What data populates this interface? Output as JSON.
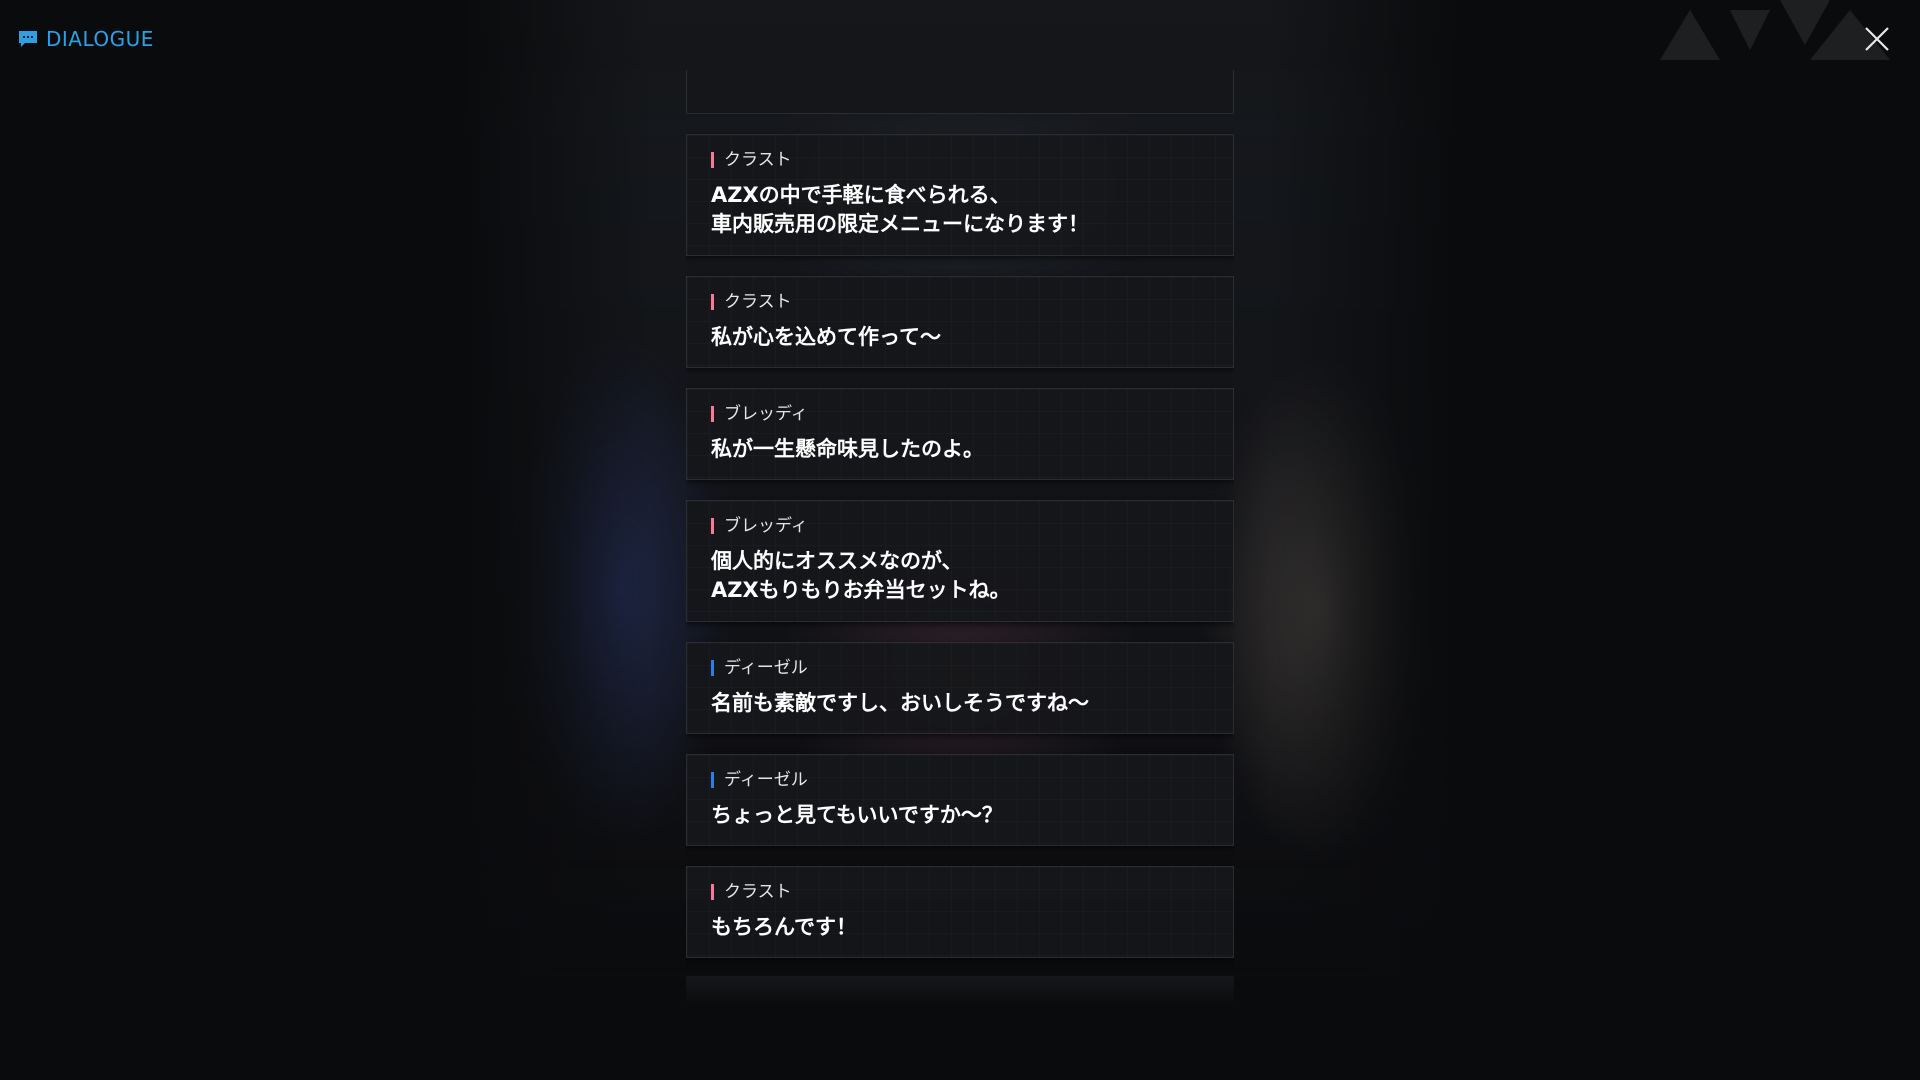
{
  "header": {
    "title": "DIALOGUE",
    "title_icon": "chat-bubble-icon",
    "close_icon": "close-icon"
  },
  "colors": {
    "accent": "#2f9fe4",
    "speaker_pink": "#f47c9a",
    "speaker_blue": "#2f7fe0"
  },
  "entries": [
    {
      "speaker": "クラスト",
      "speaker_color": "pink",
      "lines": [
        "AZXの中で手軽に食べられる、",
        "車内販売用の限定メニューになります！"
      ]
    },
    {
      "speaker": "クラスト",
      "speaker_color": "pink",
      "lines": [
        "私が心を込めて作って～"
      ]
    },
    {
      "speaker": "ブレッディ",
      "speaker_color": "pink",
      "lines": [
        "私が一生懸命味見したのよ。"
      ]
    },
    {
      "speaker": "ブレッディ",
      "speaker_color": "pink",
      "lines": [
        "個人的にオススメなのが、",
        "AZXもりもりお弁当セットね。"
      ]
    },
    {
      "speaker": "ディーゼル",
      "speaker_color": "blue",
      "lines": [
        "名前も素敵ですし、おいしそうですね～"
      ]
    },
    {
      "speaker": "ディーゼル",
      "speaker_color": "blue",
      "lines": [
        "ちょっと見てもいいですか～？"
      ]
    },
    {
      "speaker": "クラスト",
      "speaker_color": "pink",
      "lines": [
        "もちろんです！"
      ]
    }
  ]
}
